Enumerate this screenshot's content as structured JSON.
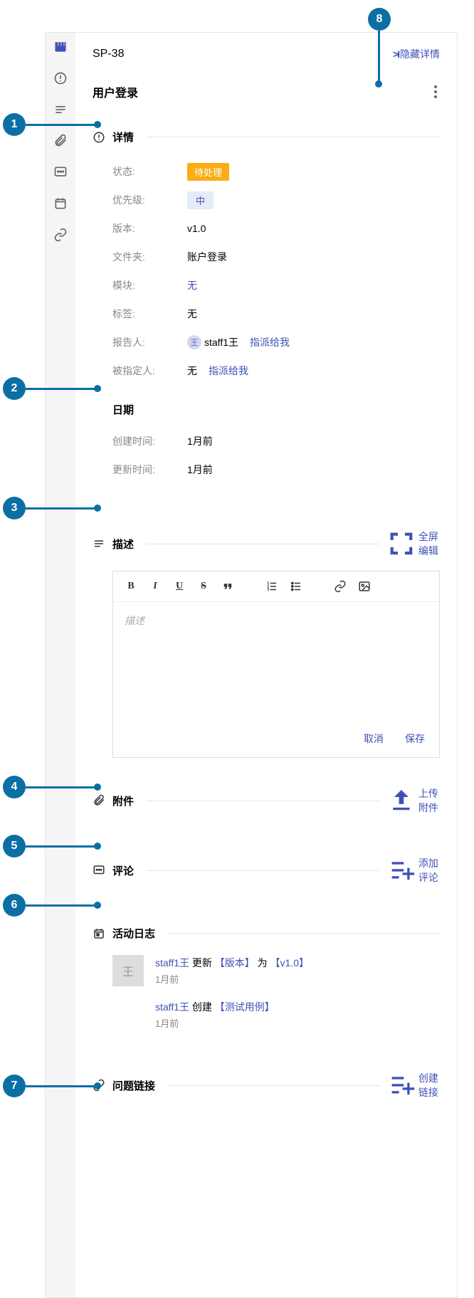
{
  "header": {
    "issue_id": "SP-38",
    "hide_detail": "隐藏详情",
    "issue_title": "用户登录"
  },
  "sections": {
    "detail_title": "详情",
    "date_title": "日期",
    "desc_title": "描述",
    "desc_action": "全屏编辑",
    "attach_title": "附件",
    "attach_action": "上传附件",
    "comment_title": "评论",
    "comment_action": "添加评论",
    "activity_title": "活动日志",
    "link_title": "问题链接",
    "link_action": "创建链接"
  },
  "fields": {
    "status_label": "状态:",
    "status_value": "待处理",
    "priority_label": "优先级:",
    "priority_value": "中",
    "version_label": "版本:",
    "version_value": "v1.0",
    "folder_label": "文件夹:",
    "folder_value": "账户登录",
    "module_label": "模块:",
    "module_value": "无",
    "tag_label": "标签:",
    "tag_value": "无",
    "reporter_label": "报告人:",
    "reporter_avatar": "王",
    "reporter_value": "staff1王",
    "reporter_assign": "指派给我",
    "assignee_label": "被指定人:",
    "assignee_value": "无",
    "assignee_assign": "指派给我",
    "created_label": "创建时间:",
    "created_value": "1月前",
    "updated_label": "更新时间:",
    "updated_value": "1月前"
  },
  "editor": {
    "placeholder": "描述",
    "cancel": "取消",
    "save": "保存"
  },
  "activity": {
    "a1_avatar": "王",
    "a1_user": "staff1王",
    "a1_action": "更新",
    "a1_field": "【版本】",
    "a1_mid": "为",
    "a1_value": "【v1.0】",
    "a1_time": "1月前",
    "a2_user": "staff1王",
    "a2_action": "创建",
    "a2_value": "【测试用例】",
    "a2_time": "1月前"
  },
  "callouts": {
    "c1": "1",
    "c2": "2",
    "c3": "3",
    "c4": "4",
    "c5": "5",
    "c6": "6",
    "c7": "7",
    "c8": "8"
  }
}
